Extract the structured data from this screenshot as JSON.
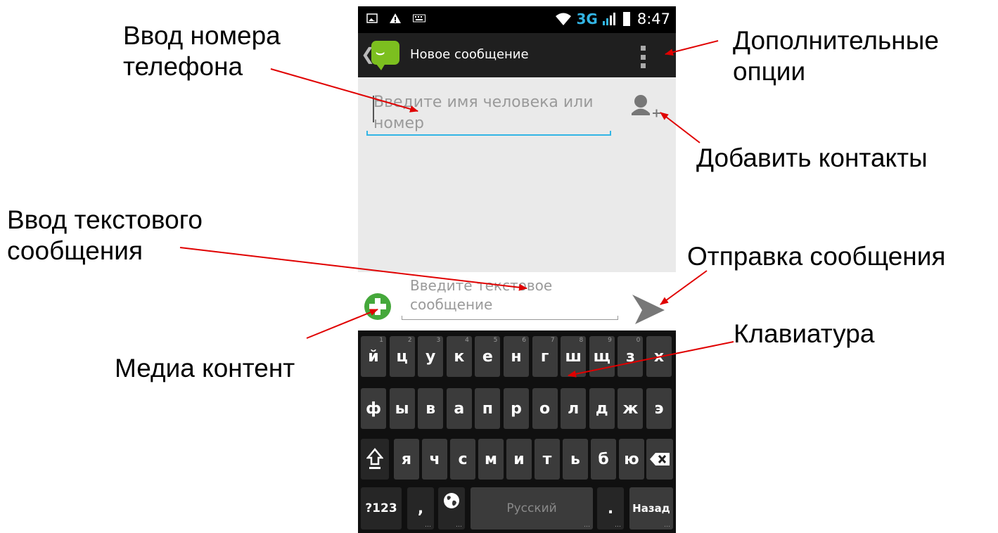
{
  "annotations": {
    "phone_input": "Ввод номера\nтелефона",
    "more_options": "Дополнительные\nопции",
    "add_contacts": "Добавить контакты",
    "text_input": "Ввод текстового\nсообщения",
    "send_message": "Отправка сообщения",
    "keyboard": "Клавиатура",
    "media": "Медиа контент"
  },
  "colors": {
    "arrow": "#e00000",
    "accent": "#33b5e5",
    "app_green": "#7cbf1f",
    "attach_green": "#45a83b"
  },
  "status_bar": {
    "icons": [
      "image-notification-icon",
      "warning-icon",
      "keyboard-notification-icon",
      "wifi-icon",
      "signal-icon",
      "battery-icon"
    ],
    "network": "3G",
    "time": "8:47"
  },
  "action_bar": {
    "title": "Новое сообщение",
    "app_icon": "messaging-app-icon",
    "overflow_icon": "overflow-menu-icon"
  },
  "recipient": {
    "placeholder": "Введите имя человека или номер"
  },
  "compose": {
    "placeholder": "Введите текстовое сообщение",
    "attach_icon": "add-media-icon",
    "send_icon": "send-icon"
  },
  "keyboard": {
    "row1": [
      {
        "label": "й",
        "hint": "1"
      },
      {
        "label": "ц",
        "hint": "2"
      },
      {
        "label": "у",
        "hint": "3"
      },
      {
        "label": "к",
        "hint": "4"
      },
      {
        "label": "е",
        "hint": "5"
      },
      {
        "label": "н",
        "hint": "6"
      },
      {
        "label": "г",
        "hint": "7"
      },
      {
        "label": "ш",
        "hint": "8"
      },
      {
        "label": "щ",
        "hint": "9"
      },
      {
        "label": "з",
        "hint": "0"
      },
      {
        "label": "х",
        "hint": ""
      }
    ],
    "row2": [
      "ф",
      "ы",
      "в",
      "а",
      "п",
      "р",
      "о",
      "л",
      "д",
      "ж",
      "э"
    ],
    "row3": [
      "я",
      "ч",
      "с",
      "м",
      "и",
      "т",
      "ь",
      "б",
      "ю"
    ],
    "shift_icon": "shift-icon",
    "backspace_icon": "backspace-icon",
    "symbols": "?123",
    "comma": ",",
    "globe_icon": "globe-icon",
    "space": "Русский",
    "period": ".",
    "enter": "Назад",
    "more_hint": "…"
  }
}
